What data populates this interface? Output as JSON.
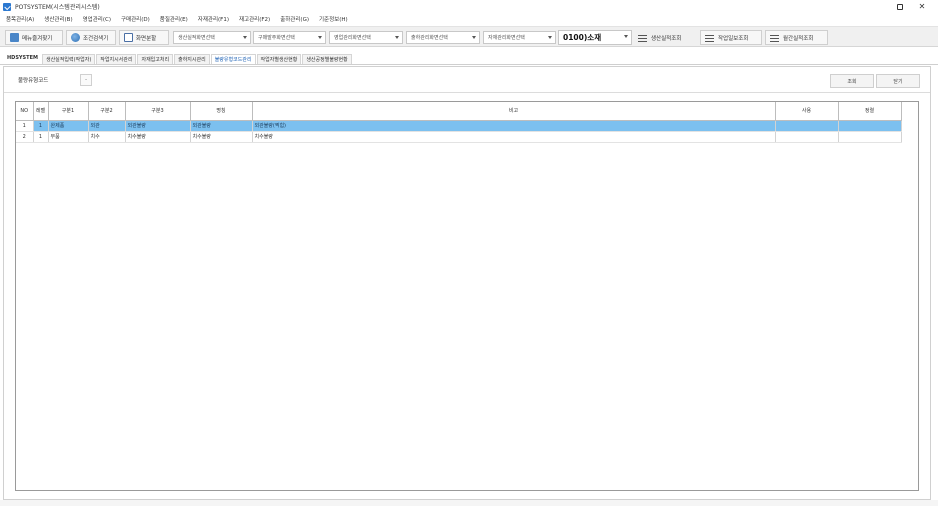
{
  "window": {
    "title": "POTSYSTEM(시스템관리시스템)",
    "restore_glyph": "",
    "close_glyph": "✕"
  },
  "menu": [
    "품목관리(A)",
    "생산관리(B)",
    "영업관리(C)",
    "구매관리(D)",
    "품질관리(E)",
    "자재관리(F1)",
    "재고관리(F2)",
    "출하관리(G)",
    "기준정보(H)"
  ],
  "toolbar": {
    "btn_1": "메뉴즐겨찾기",
    "btn_2": "조건검색기",
    "btn_3": "화면분할",
    "combo_1": "생산실적화면선택",
    "combo_2": "구매발주화면선택",
    "combo_3": "영업관리화면선택",
    "combo_4": "출하관리화면선택",
    "combo_5": "자재관리화면선택",
    "code_value": "0100)소재",
    "list_btn_1": "생산실적조회",
    "list_btn_2": "작업일보조회",
    "list_btn_3": "월간실적조회"
  },
  "tabs": [
    "HDSYSTEM",
    "생산실적입력(작업자)",
    "작업지시서관리",
    "자재입고처리",
    "출하지시관리",
    "불량유형코드관리",
    "작업자별생산현황",
    "생산공정별불량현황"
  ],
  "active_tab_index": 5,
  "filter": {
    "label": "불량유형코드",
    "combo_value": "-"
  },
  "actions": {
    "search": "조회",
    "close": "닫기"
  },
  "table": {
    "columns": [
      "NO",
      "레벨",
      "구분1",
      "구분2",
      "구분3",
      "명칭",
      "비고",
      "사용",
      "정렬"
    ],
    "rows": [
      {
        "no": "1",
        "level": "1",
        "c1": "완제품",
        "c2": "외관",
        "c3": "외관불량",
        "name": "외관불량",
        "remark": "외관불량(찍힘)",
        "use": "",
        "sort": ""
      },
      {
        "no": "2",
        "level": "1",
        "c1": "부품",
        "c2": "치수",
        "c3": "치수불량",
        "name": "치수불량",
        "remark": "치수불량",
        "use": "",
        "sort": ""
      }
    ],
    "selected_row": 0
  },
  "colors": {
    "selection": "#7cc0ef",
    "accent": "#2b78d0"
  }
}
